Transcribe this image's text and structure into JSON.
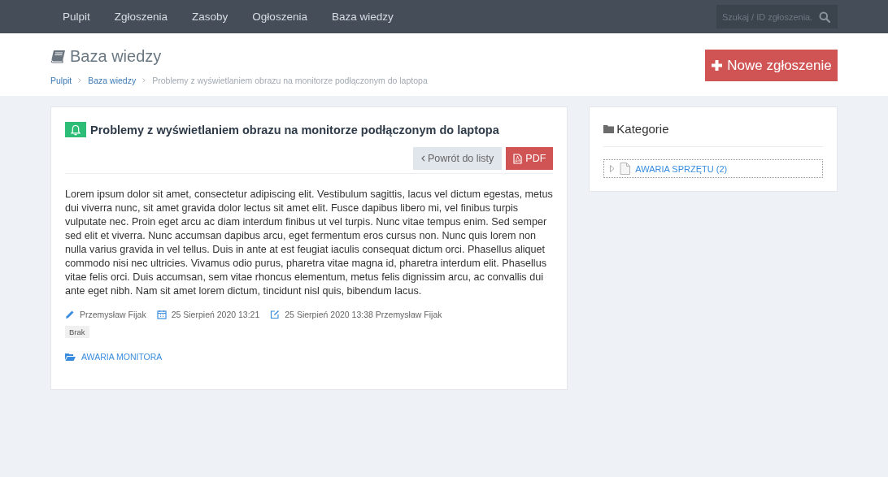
{
  "nav": {
    "items": [
      "Pulpit",
      "Zgłoszenia",
      "Zasoby",
      "Ogłoszenia",
      "Baza wiedzy"
    ],
    "search": {
      "placeholder": "Szukaj / ID zgłoszenia."
    }
  },
  "header": {
    "title": "Baza wiedzy",
    "breadcrumbs": [
      "Pulpit",
      "Baza wiedzy",
      "Problemy z wyświetlaniem obrazu na monitorze podłączonym do laptopa"
    ],
    "new_button": "Nowe zgłoszenie"
  },
  "article": {
    "title": "Problemy z wyświetlaniem obrazu na monitorze podłączonym do laptopa",
    "back_button": "Powrót do listy",
    "pdf_button": "PDF",
    "body": "Lorem ipsum dolor sit amet, consectetur adipiscing elit. Vestibulum sagittis, lacus vel dictum egestas, metus dui viverra nunc, sit amet gravida dolor lectus sit amet elit. Fusce dapibus libero mi, vel finibus turpis vulputate nec. Proin eget arcu ac diam interdum finibus ut vel turpis. Nunc vitae tempus enim. Sed semper sed elit et viverra. Nunc accumsan dapibus arcu, eget fermentum eros cursus non. Nunc quis lorem non nulla varius gravida in vel tellus. Duis in ante at est feugiat iaculis consequat dictum orci. Phasellus aliquet commodo nisi nec ultricies. Vivamus odio purus, pharetra vitae magna id, pharetra interdum elit. Phasellus vitae felis orci. Duis accumsan, sem vitae rhoncus elementum, metus felis dignissim arcu, ac convallis dui ante eget nibh. Nam sit amet lorem dictum, tincidunt nisl quis, bibendum lacus.",
    "author": "Przemysław Fijak",
    "created": "25 Sierpień 2020 13:21",
    "modified": "25 Sierpień 2020 13:38 Przemysław Fijak",
    "tag": "Brak",
    "category": "AWARIA MONITORA"
  },
  "sidebar": {
    "title": "Kategorie",
    "tree": [
      {
        "label": "AWARIA SPRZĘTU (2)",
        "expanded": false
      }
    ]
  }
}
